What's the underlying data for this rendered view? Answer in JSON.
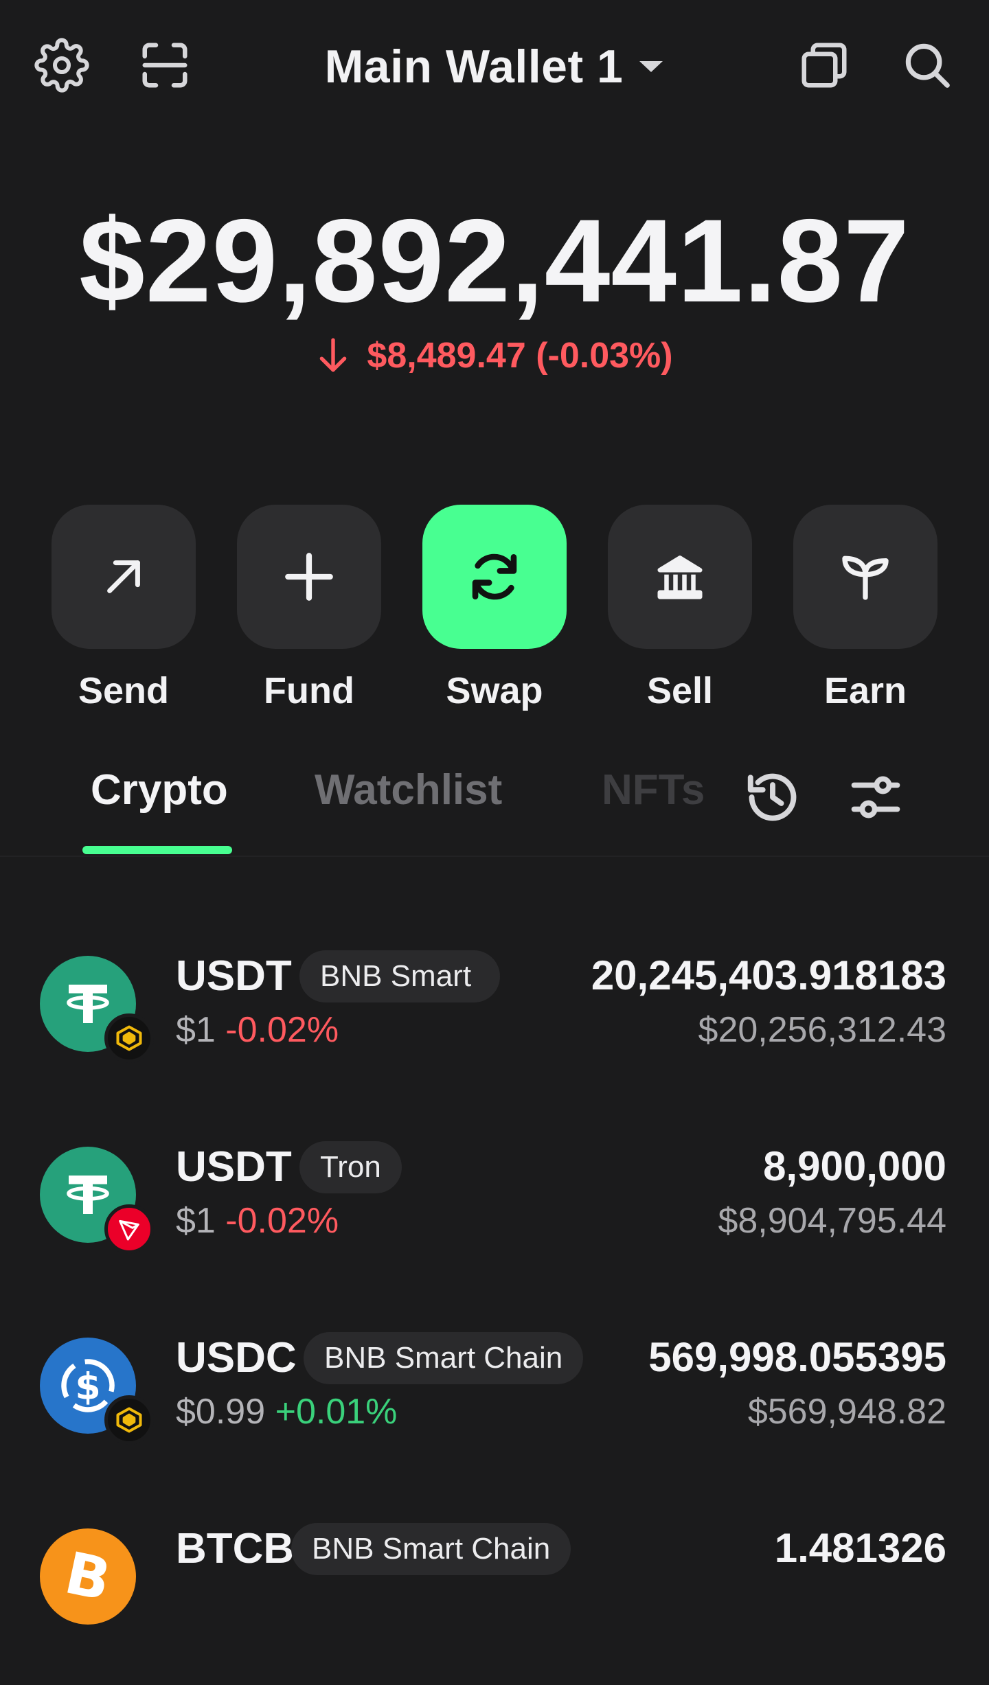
{
  "header": {
    "wallet_name": "Main Wallet 1",
    "icons": [
      "gear-icon",
      "scan-icon",
      "chevron-down-icon",
      "copy-icon",
      "search-icon"
    ]
  },
  "balance": {
    "total": "$29,892,441.87",
    "change": "$8,489.47 (-0.03%)",
    "change_direction": "down",
    "change_color": "#ff5a5f"
  },
  "actions": [
    {
      "label": "Send",
      "icon": "arrow-up-right-icon"
    },
    {
      "label": "Fund",
      "icon": "plus-icon"
    },
    {
      "label": "Swap",
      "icon": "swap-icon",
      "highlight": true
    },
    {
      "label": "Sell",
      "icon": "bank-icon"
    },
    {
      "label": "Earn",
      "icon": "sprout-icon"
    }
  ],
  "tabs": [
    {
      "label": "Crypto",
      "active": true
    },
    {
      "label": "Watchlist",
      "active": false
    },
    {
      "label": "NFTs",
      "active": false
    }
  ],
  "tab_icons": [
    "history-icon",
    "filter-icon"
  ],
  "assets": [
    {
      "symbol": "USDT",
      "network": "BNB Smart",
      "price": "$1",
      "change": "-0.02%",
      "amount": "20,245,403.918183",
      "fiat": "$20,256,312.43",
      "coin_icon": "tether-icon",
      "chain_icon": "bnb-icon"
    },
    {
      "symbol": "USDT",
      "network": "Tron",
      "price": "$1",
      "change": "-0.02%",
      "amount": "8,900,000",
      "fiat": "$8,904,795.44",
      "coin_icon": "tether-icon",
      "chain_icon": "tron-icon"
    },
    {
      "symbol": "USDC",
      "network": "BNB Smart Chain",
      "price": "$0.99",
      "change": "+0.01%",
      "amount": "569,998.055395",
      "fiat": "$569,948.82",
      "coin_icon": "usdc-icon",
      "chain_icon": "bnb-icon"
    },
    {
      "symbol": "BTCB",
      "network": "BNB Smart Chain",
      "amount": "1.481326",
      "coin_icon": "bitcoin-icon"
    }
  ],
  "colors": {
    "background": "#1b1b1c",
    "accent": "#48ff91",
    "negative": "#ff5a5f",
    "positive": "#3ad17b",
    "tether": "#26a17b",
    "usdc": "#2775ca",
    "bitcoin": "#f7931a",
    "tron": "#eb0029",
    "bnb": "#f0b90b"
  }
}
